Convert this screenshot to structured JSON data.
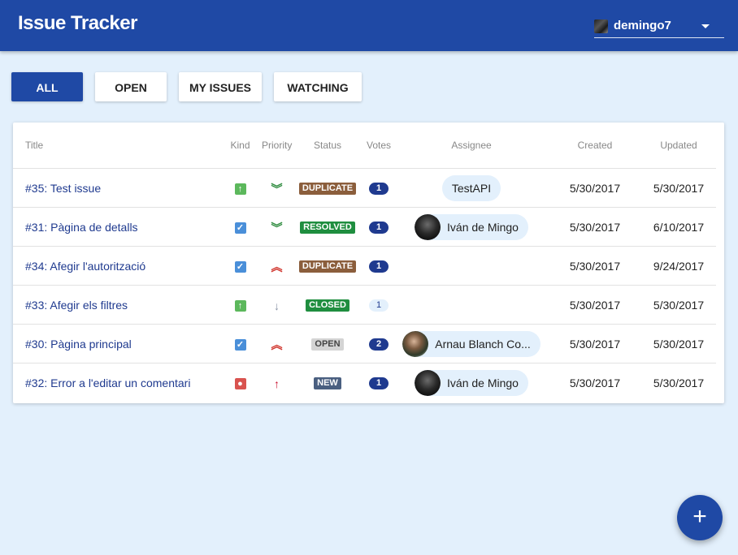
{
  "app": {
    "title": "Issue Tracker"
  },
  "user": {
    "name": "demingo7"
  },
  "filters": [
    {
      "label": "ALL",
      "active": true
    },
    {
      "label": "OPEN",
      "active": false
    },
    {
      "label": "MY ISSUES",
      "active": false
    },
    {
      "label": "WATCHING",
      "active": false
    }
  ],
  "table": {
    "columns": {
      "title": "Title",
      "kind": "Kind",
      "priority": "Priority",
      "status": "Status",
      "votes": "Votes",
      "assignee": "Assignee",
      "created": "Created",
      "updated": "Updated"
    },
    "rows": [
      {
        "title": "#35: Test issue",
        "kind": "improvement",
        "priority": "minor",
        "status": "DUPLICATE",
        "votes": "1",
        "assignee": "TestAPI",
        "created": "5/30/2017",
        "updated": "5/30/2017"
      },
      {
        "title": "#31: Pàgina de detalls",
        "kind": "task",
        "priority": "minor",
        "status": "RESOLVED",
        "votes": "1",
        "assignee": "Iván de Mingo",
        "created": "5/30/2017",
        "updated": "6/10/2017"
      },
      {
        "title": "#34: Afegir l'autorització",
        "kind": "task",
        "priority": "major",
        "status": "DUPLICATE",
        "votes": "1",
        "assignee": "",
        "created": "5/30/2017",
        "updated": "9/24/2017"
      },
      {
        "title": "#33: Afegir els filtres",
        "kind": "improvement",
        "priority": "trivial",
        "status": "CLOSED",
        "votes": "1",
        "assignee": "",
        "created": "5/30/2017",
        "updated": "5/30/2017"
      },
      {
        "title": "#30: Pàgina principal",
        "kind": "task",
        "priority": "major",
        "status": "OPEN",
        "votes": "2",
        "assignee": "Arnau Blanch Co...",
        "created": "5/30/2017",
        "updated": "5/30/2017"
      },
      {
        "title": "#32: Error a l'editar un comentari",
        "kind": "bug",
        "priority": "blocker",
        "status": "NEW",
        "votes": "1",
        "assignee": "Iván de Mingo",
        "created": "5/30/2017",
        "updated": "5/30/2017"
      }
    ]
  },
  "fab": {
    "icon": "plus-icon",
    "glyph": "+"
  },
  "colors": {
    "primary": "#1f49a5",
    "background": "#e3f0fc"
  }
}
